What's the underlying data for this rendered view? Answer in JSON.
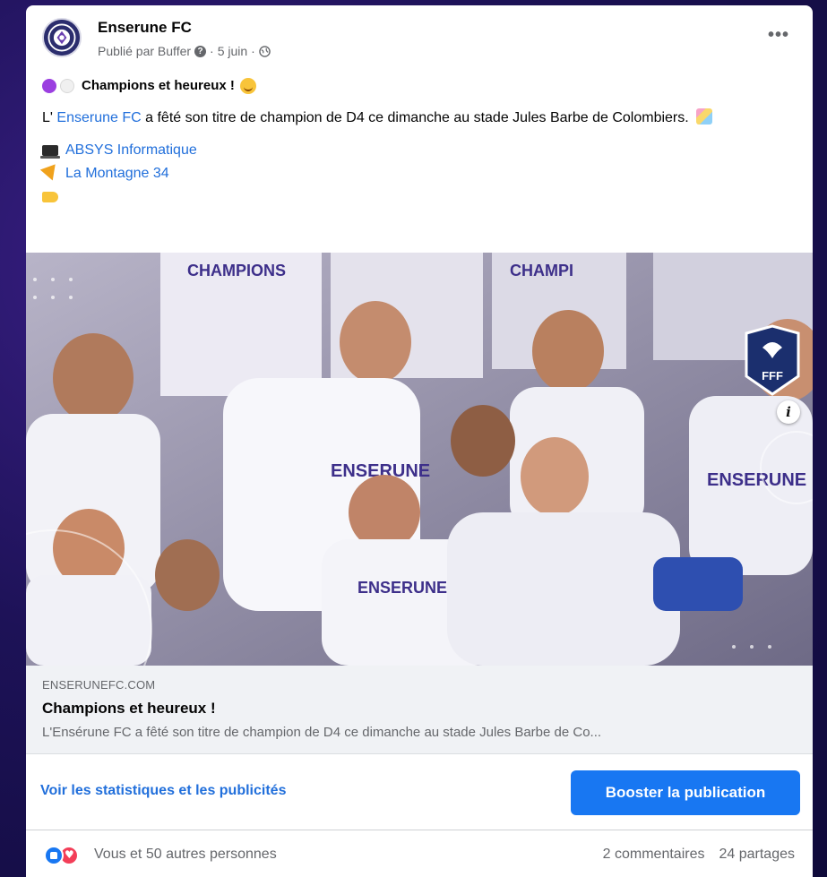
{
  "post": {
    "page_name": "Enserune FC",
    "published_by": "Publié par Buffer",
    "help_icon": "question-circle-icon",
    "date": "5 juin",
    "visibility_icon": "globe-icon",
    "more_label": "•••"
  },
  "content": {
    "headline": "Champions et heureux !",
    "para_prefix": "L'",
    "para_link": "Enserune FC",
    "para_text": "a fêté son titre de champion de D4 ce dimanche au stade Jules Barbe de Colombiers.",
    "sponsor1": "ABSYS Informatique",
    "sponsor2": "La Montagne 34"
  },
  "link_preview": {
    "domain": "ENSERUNEFC.COM",
    "title": "Champions et heureux !",
    "description": "L'Ensérune FC a fêté son titre de champion de D4 ce dimanche au stade Jules Barbe de Co...",
    "badge_text": "FFF",
    "info_label": "i"
  },
  "actions": {
    "stats_link": "Voir les statistiques et les publicités",
    "boost_button": "Booster la publication"
  },
  "footer": {
    "reactions_text": "Vous et 50 autres personnes",
    "comments": "2 commentaires",
    "shares": "24 partages"
  },
  "colors": {
    "accent": "#1877f2",
    "link": "#216fdb",
    "background": "#1d1257"
  }
}
